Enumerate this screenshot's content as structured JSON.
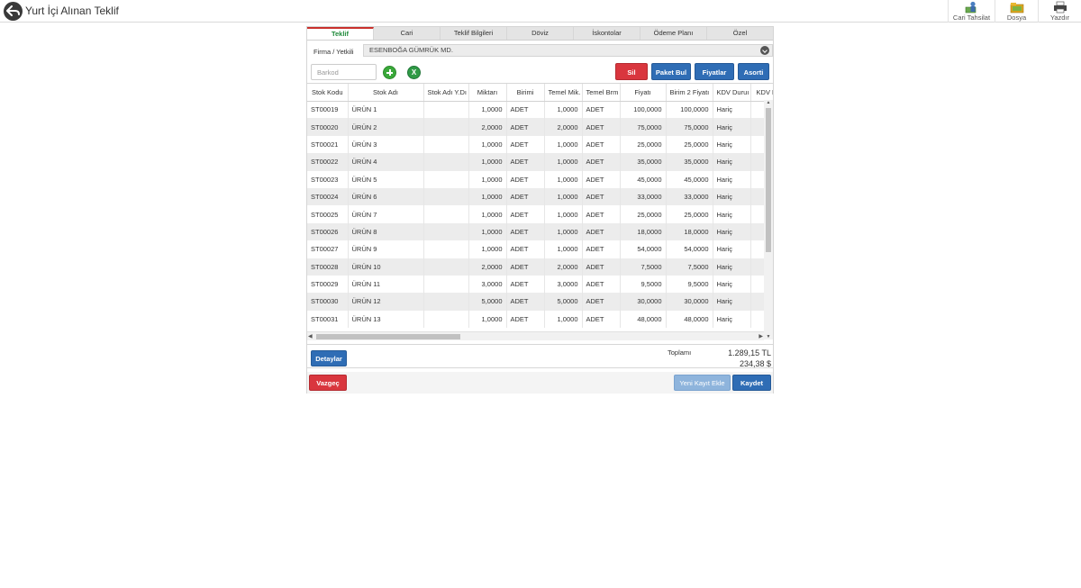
{
  "header": {
    "title": "Yurt İçi Alınan Teklif",
    "actions": [
      {
        "label": "Cari Tahsilat",
        "icon": "cash-collection-icon"
      },
      {
        "label": "Dosya",
        "icon": "folder-icon"
      },
      {
        "label": "Yazdır",
        "icon": "printer-icon"
      }
    ]
  },
  "tabs": [
    "Teklif",
    "Cari",
    "Teklif Bilgileri",
    "Döviz",
    "İskontolar",
    "Ödeme Planı",
    "Özel"
  ],
  "active_tab": "Teklif",
  "firm": {
    "label": "Firma / Yetkili",
    "value": "ESENBOĞA GÜMRÜK MD."
  },
  "toolbar": {
    "barkod_placeholder": "Barkod",
    "sil": "Sil",
    "paket_bul": "Paket Bul",
    "fiyatlar": "Fiyatlar",
    "asorti": "Asorti"
  },
  "table": {
    "columns": [
      "Stok Kodu",
      "Stok Adı",
      "Stok Adı Y.Dı",
      "Miktarı",
      "Birimi",
      "Temel Mik.",
      "Temel Brm",
      "Fiyatı",
      "Birim 2 Fiyatı",
      "KDV Duruı",
      "KDV H"
    ],
    "rows": [
      [
        "ST00019",
        "ÜRÜN 1",
        "",
        "1,0000",
        "ADET",
        "1,0000",
        "ADET",
        "100,0000",
        "100,0000",
        "Hariç",
        ""
      ],
      [
        "ST00020",
        "ÜRÜN 2",
        "",
        "2,0000",
        "ADET",
        "2,0000",
        "ADET",
        "75,0000",
        "75,0000",
        "Hariç",
        ""
      ],
      [
        "ST00021",
        "ÜRÜN 3",
        "",
        "1,0000",
        "ADET",
        "1,0000",
        "ADET",
        "25,0000",
        "25,0000",
        "Hariç",
        ""
      ],
      [
        "ST00022",
        "ÜRÜN 4",
        "",
        "1,0000",
        "ADET",
        "1,0000",
        "ADET",
        "35,0000",
        "35,0000",
        "Hariç",
        ""
      ],
      [
        "ST00023",
        "ÜRÜN 5",
        "",
        "1,0000",
        "ADET",
        "1,0000",
        "ADET",
        "45,0000",
        "45,0000",
        "Hariç",
        ""
      ],
      [
        "ST00024",
        "ÜRÜN 6",
        "",
        "1,0000",
        "ADET",
        "1,0000",
        "ADET",
        "33,0000",
        "33,0000",
        "Hariç",
        ""
      ],
      [
        "ST00025",
        "ÜRÜN 7",
        "",
        "1,0000",
        "ADET",
        "1,0000",
        "ADET",
        "25,0000",
        "25,0000",
        "Hariç",
        ""
      ],
      [
        "ST00026",
        "ÜRÜN 8",
        "",
        "1,0000",
        "ADET",
        "1,0000",
        "ADET",
        "18,0000",
        "18,0000",
        "Hariç",
        ""
      ],
      [
        "ST00027",
        "ÜRÜN 9",
        "",
        "1,0000",
        "ADET",
        "1,0000",
        "ADET",
        "54,0000",
        "54,0000",
        "Hariç",
        ""
      ],
      [
        "ST00028",
        "ÜRÜN 10",
        "",
        "2,0000",
        "ADET",
        "2,0000",
        "ADET",
        "7,5000",
        "7,5000",
        "Hariç",
        ""
      ],
      [
        "ST00029",
        "ÜRÜN 11",
        "",
        "3,0000",
        "ADET",
        "3,0000",
        "ADET",
        "9,5000",
        "9,5000",
        "Hariç",
        ""
      ],
      [
        "ST00030",
        "ÜRÜN 12",
        "",
        "5,0000",
        "ADET",
        "5,0000",
        "ADET",
        "30,0000",
        "30,0000",
        "Hariç",
        ""
      ],
      [
        "ST00031",
        "ÜRÜN 13",
        "",
        "1,0000",
        "ADET",
        "1,0000",
        "ADET",
        "48,0000",
        "48,0000",
        "Hariç",
        ""
      ]
    ]
  },
  "summary": {
    "detaylar": "Detaylar",
    "toplam_label": "Toplamı",
    "total_tl": "1.289,15 TL",
    "total_usd": "234,38 $"
  },
  "footer": {
    "vazgec": "Vazgeç",
    "yeni_kayit": "Yeni Kayıt Ekle",
    "kaydet": "Kaydet"
  }
}
